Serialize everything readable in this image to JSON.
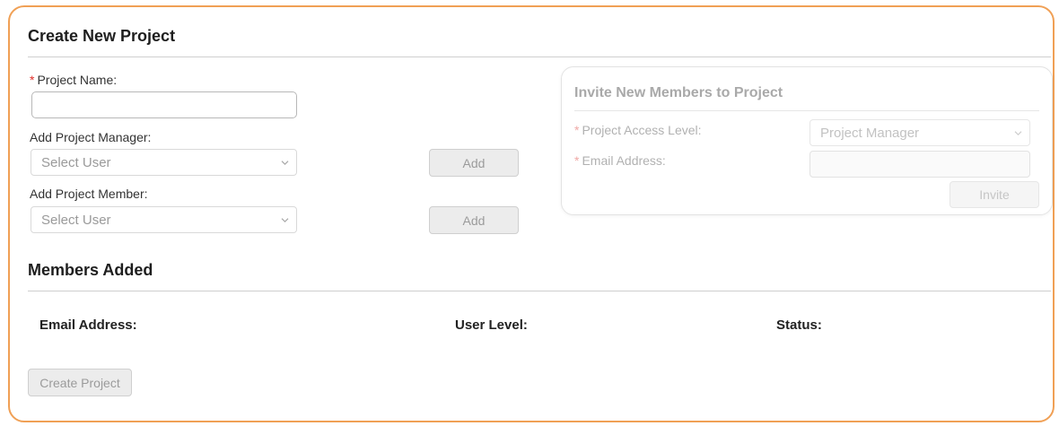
{
  "form": {
    "title": "Create New Project",
    "project_name_label": "Project Name:",
    "required_mark": "*",
    "project_name_value": "",
    "manager_label": "Add Project Manager:",
    "manager_select_value": "Select User",
    "manager_add_label": "Add",
    "member_label": "Add Project Member:",
    "member_select_value": "Select User",
    "member_add_label": "Add"
  },
  "invite": {
    "title": "Invite New Members to Project",
    "access_level_label": "Project Access Level:",
    "access_level_value": "Project Manager",
    "email_label": "Email Address:",
    "email_value": "",
    "invite_button_label": "Invite"
  },
  "members": {
    "title": "Members Added",
    "columns": [
      "Email Address:",
      "User Level:",
      "Status:"
    ]
  },
  "actions": {
    "create_label": "Create Project"
  },
  "colors": {
    "panel_border": "#f0a055",
    "required": "#e0302a"
  }
}
